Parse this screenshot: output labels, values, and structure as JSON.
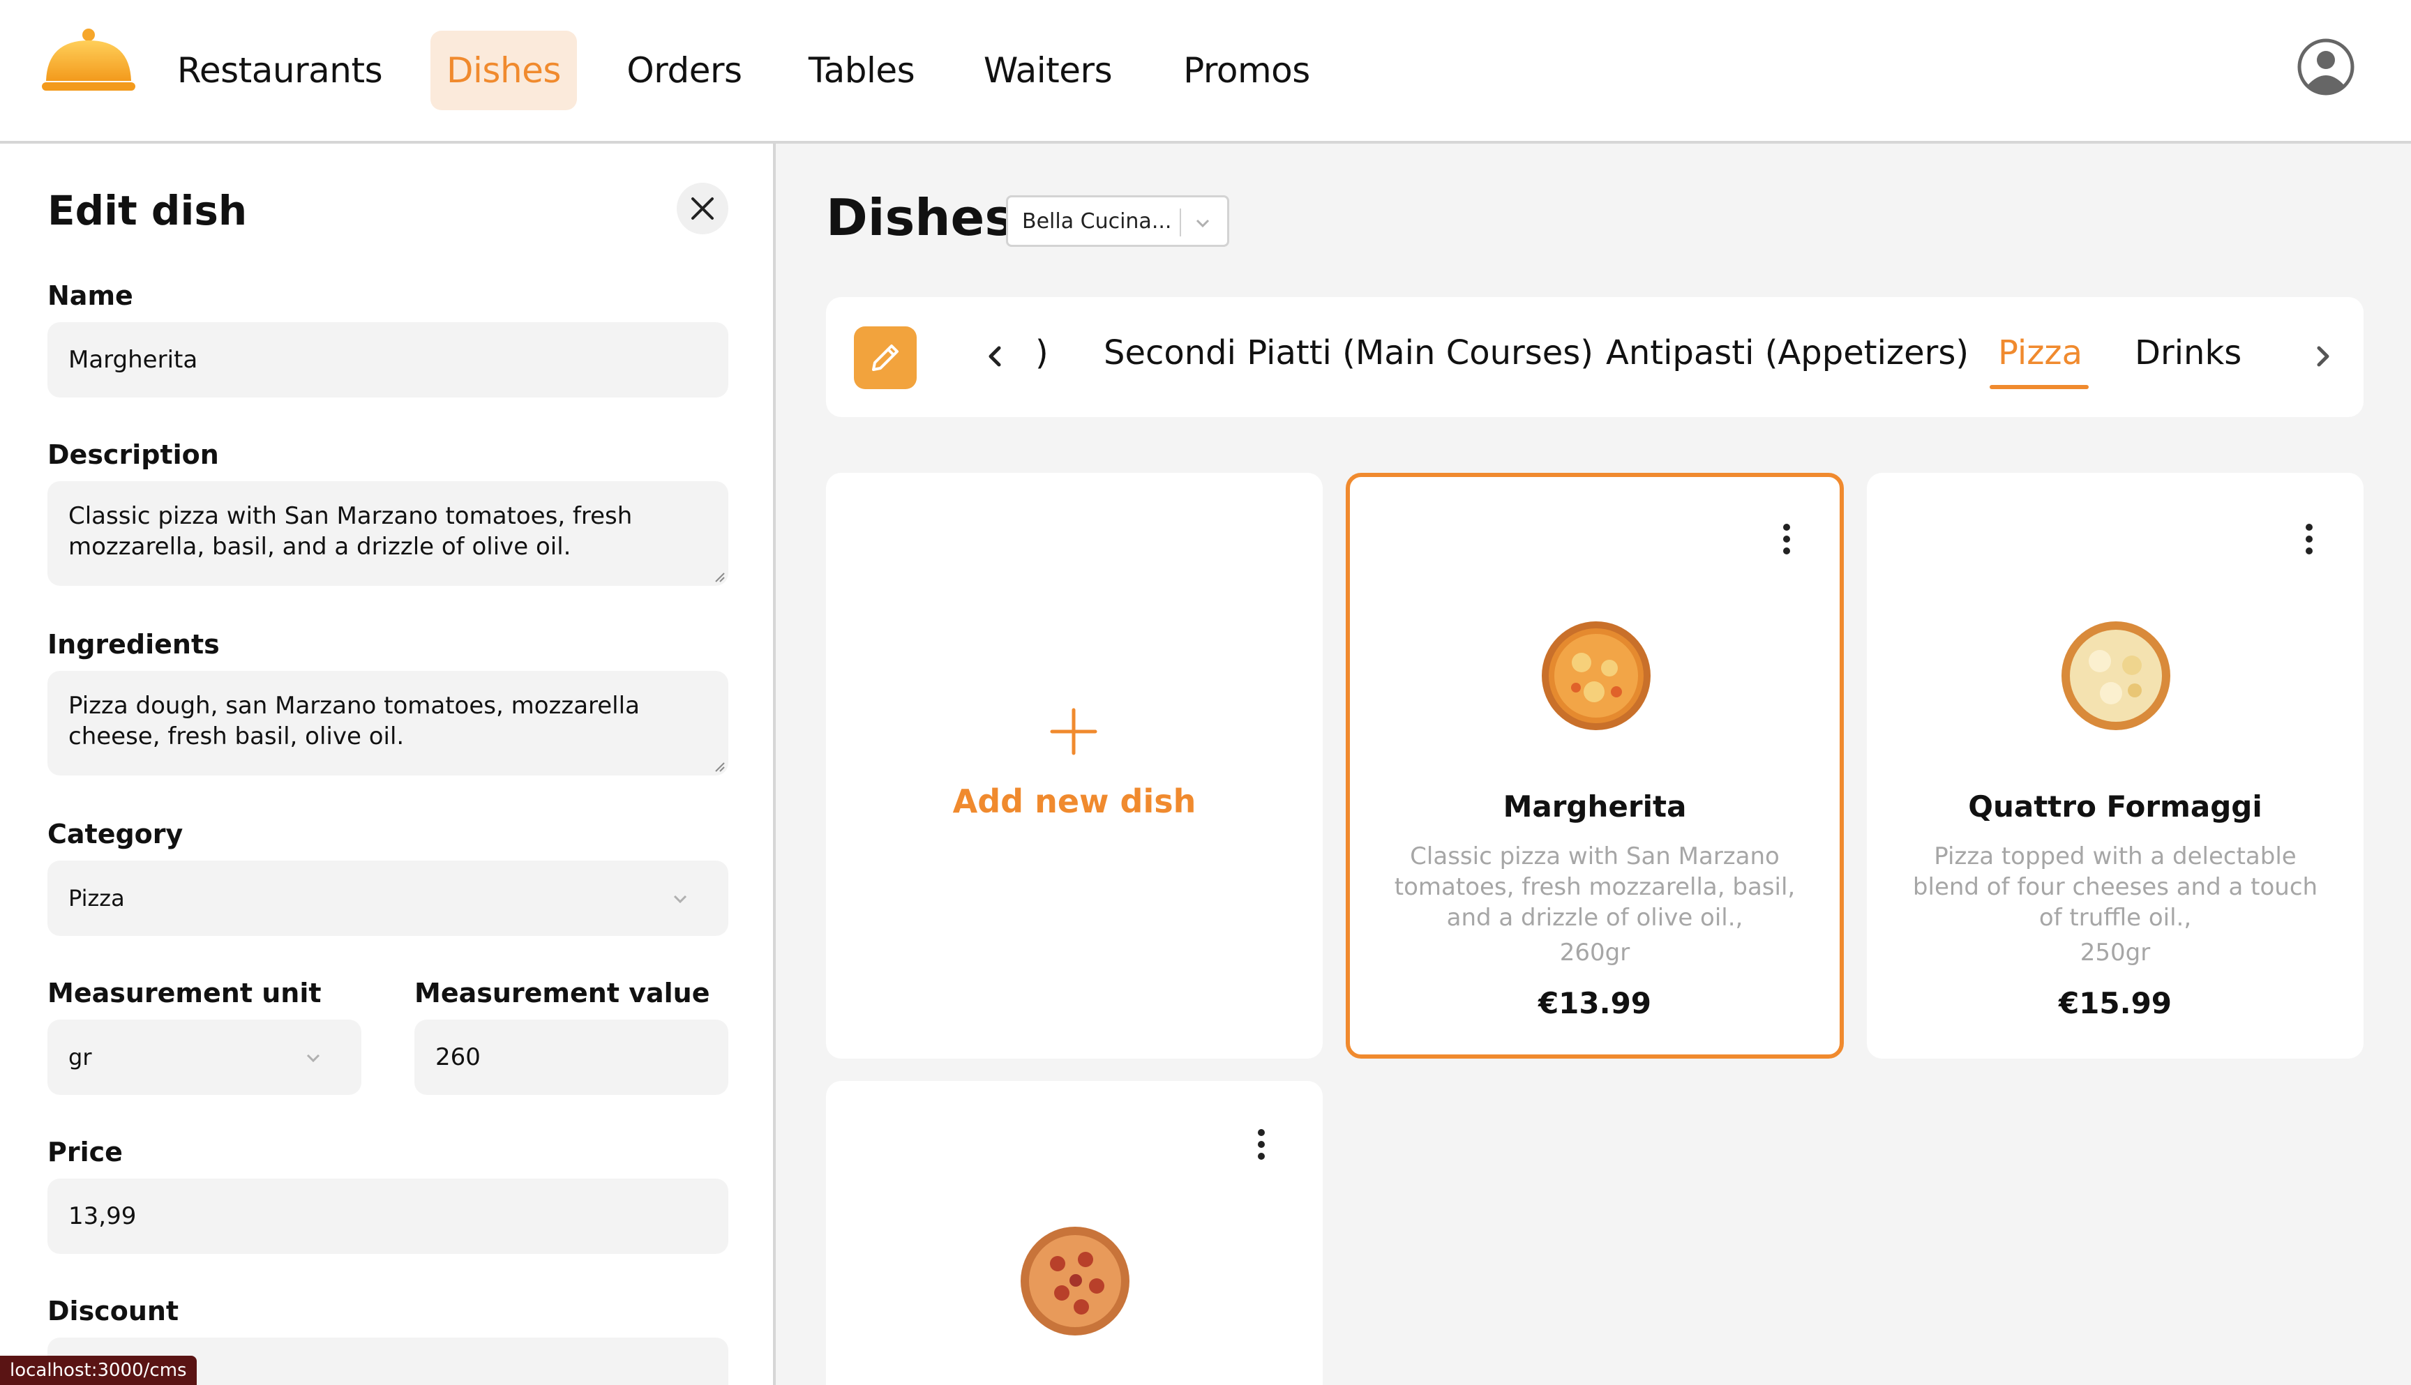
{
  "nav": {
    "items": [
      {
        "label": "Restaurants"
      },
      {
        "label": "Dishes",
        "active": true
      },
      {
        "label": "Orders"
      },
      {
        "label": "Tables"
      },
      {
        "label": "Waiters"
      },
      {
        "label": "Promos"
      }
    ],
    "logo_icon": "cloche-icon",
    "account_icon": "user-circle-icon"
  },
  "edit_panel": {
    "title": "Edit dish",
    "close_icon": "close-icon",
    "name": {
      "label": "Name",
      "value": "Margherita"
    },
    "description": {
      "label": "Description",
      "value": "Classic pizza with San Marzano tomatoes, fresh mozzarella, basil, and a drizzle of olive oil."
    },
    "ingredients": {
      "label": "Ingredients",
      "value": "Pizza dough, san Marzano tomatoes, mozzarella cheese, fresh basil, olive oil."
    },
    "category": {
      "label": "Category",
      "value": "Pizza"
    },
    "measurement_unit": {
      "label": "Measurement unit",
      "value": "gr"
    },
    "measurement_value": {
      "label": "Measurement value",
      "value": "260"
    },
    "price": {
      "label": "Price",
      "value": "13,99"
    },
    "discount": {
      "label": "Discount",
      "value": ""
    }
  },
  "content": {
    "title": "Dishes",
    "restaurant_select": "Bella Cucina...",
    "categories": {
      "partial_tab": ")",
      "tabs": [
        {
          "label": "Secondi Piatti (Main Courses)"
        },
        {
          "label": "Antipasti (Appetizers)"
        },
        {
          "label": "Pizza",
          "active": true
        },
        {
          "label": "Drinks"
        }
      ]
    },
    "add_card": {
      "label": "Add new dish"
    },
    "dishes": [
      {
        "name": "Margherita",
        "description": "Classic pizza with San Marzano tomatoes, fresh mozzarella, basil, and a drizzle of olive oil.,",
        "weight": "260gr",
        "price": "€13.99",
        "selected": true
      },
      {
        "name": "Quattro Formaggi",
        "description": "Pizza topped with a delectable blend of four cheeses and a touch of truffle oil.,",
        "weight": "250gr",
        "price": "€15.99",
        "selected": false
      }
    ]
  },
  "status_url": "localhost:3000/cms",
  "colors": {
    "accent": "#f08a2e",
    "accent_bg": "#fbeadb",
    "edit_button": "#f2a33d",
    "field_bg": "#f3f3f3",
    "page_bg": "#f4f4f4"
  }
}
